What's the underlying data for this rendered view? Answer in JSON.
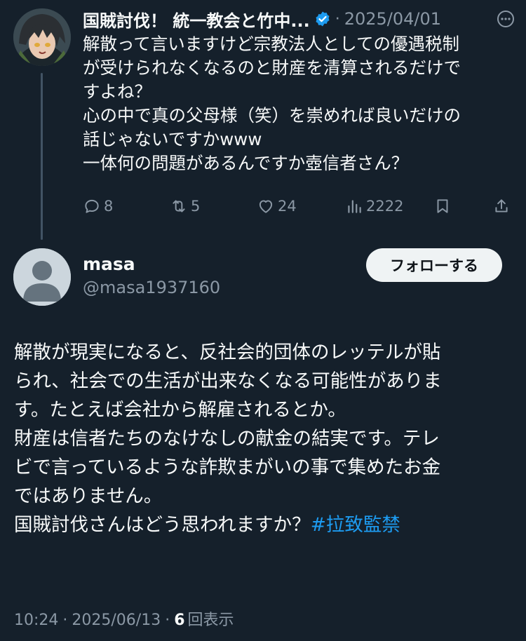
{
  "parent_tweet": {
    "author_name": "国賊討伐！ 統一教会と竹中...",
    "separator": "·",
    "date": "2025/04/01",
    "text": "解散って言いますけど宗教法人としての優遇税制\nが受けられなくなるのと財産を清算されるだけで\nすよね？\n心の中で真の父母様（笑）を崇めれば良いだけの\n話じゃないですかwww\n一体何の問題があるんですか壺信者さん？",
    "stats": {
      "replies": "8",
      "retweets": "5",
      "likes": "24",
      "views": "2222"
    }
  },
  "reply_tweet": {
    "author_name": "masa",
    "author_handle": "@masa1937160",
    "follow_label": "フォローする",
    "text_main": "解散が現実になると、反社会的団体のレッテルが貼\nられ、社会での生活が出来なくなる可能性がありま\nす。たとえば会社から解雇されるとか。\n財産は信者たちのなけなしの献金の結実です。テレ\nビで言っているような詐欺まがいの事で集めたお金\nではありません。\n国賊討伐さんはどう思われますか？",
    "hashtag": "#拉致監禁",
    "time": "10:24",
    "separator": "·",
    "date": "2025/06/13",
    "separator2": "·",
    "views_count": "6",
    "views_label": "回表示"
  },
  "icons": {
    "verified": "verified-badge-icon",
    "more": "more-options-icon",
    "reply": "reply-icon",
    "retweet": "retweet-icon",
    "like": "heart-icon",
    "views": "views-chart-icon",
    "bookmark": "bookmark-icon",
    "share": "share-icon"
  },
  "colors": {
    "background": "#15202b",
    "text": "#f7f9f9",
    "muted": "#8b98a5",
    "accent": "#1d9bf0",
    "thread_line": "#425364"
  }
}
